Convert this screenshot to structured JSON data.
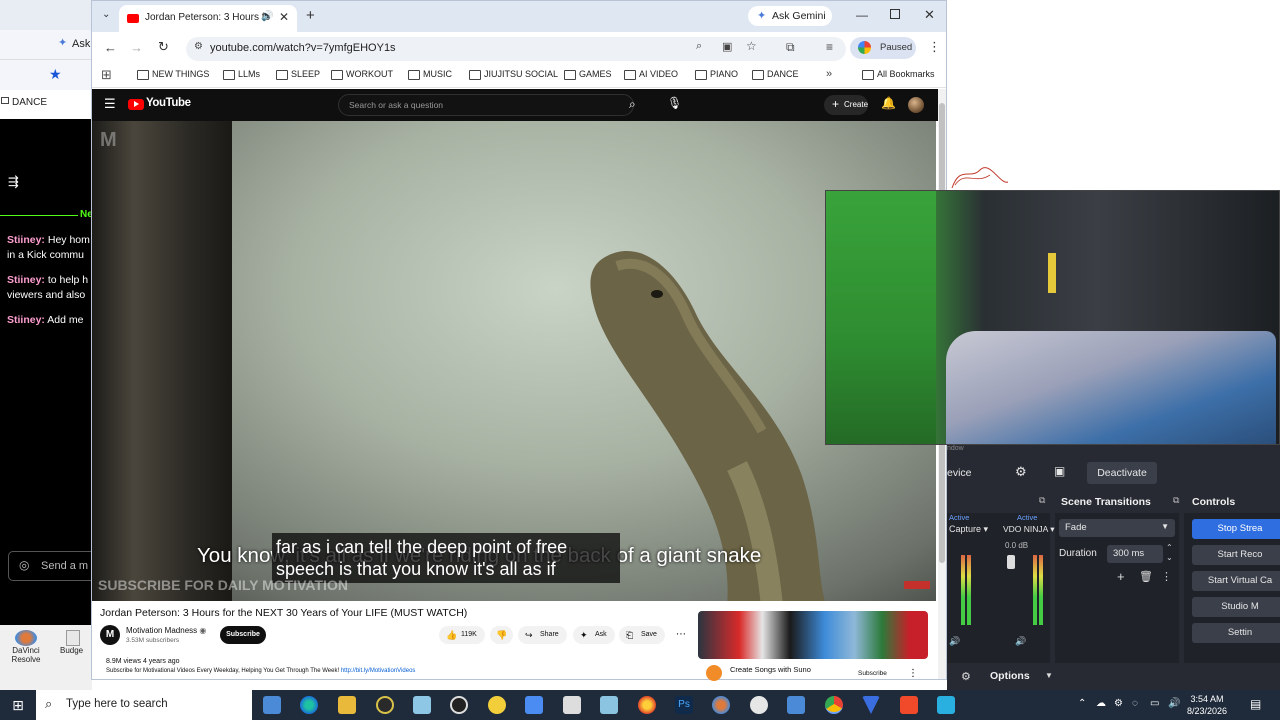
{
  "browser": {
    "tab_title": "Jordan Peterson: 3 Hours fo",
    "new_tab_symbol": "+",
    "ask_gemini": "Ask Gemini",
    "url": "youtube.com/watch?v=7ymfgEHOY1s",
    "profile_status": "Paused",
    "bookmarks": [
      "NEW THINGS",
      "LLMs",
      "SLEEP",
      "WORKOUT",
      "MUSIC",
      "JIUJITSU SOCIAL",
      "GAMES",
      "AI VIDEO",
      "PIANO",
      "DANCE"
    ],
    "all_bookmarks": "All Bookmarks"
  },
  "youtube": {
    "logo": "YouTube",
    "search_placeholder": "Search or ask a question",
    "create_label": "Create",
    "captions": {
      "line_a": "You know, it's all as if we're riding on the back of a giant snake",
      "line_b1": "far as i can tell the deep point of free",
      "line_b2": "speech is that you know it's all as if"
    },
    "video_watermark": "SUBSCRIBE FOR DAILY MOTIVATION",
    "video_title": "Jordan Peterson: 3 Hours for the NEXT 30 Years of Your LIFE (MUST WATCH)",
    "channel": {
      "avatar_letter": "M",
      "name": "Motivation Madness",
      "subs": "3.53M subscribers",
      "subscribe": "Subscribe"
    },
    "actions": {
      "likes": "119K",
      "share": "Share",
      "ask": "Ask",
      "save": "Save"
    },
    "meta": {
      "views": "8.9M views  4 years ago",
      "description": "Subscribe for Motivational Videos Every Weekday, Helping You Get Through The Week! ",
      "link": "http://bit.ly/MotivationVideos"
    },
    "ad": {
      "title": "Create Songs with Suno",
      "subscribe": "Subscribe"
    }
  },
  "left_panel": {
    "ask_tab": "Ask",
    "dance_bookmark": "DANCE",
    "chat_new_marker": "Ne",
    "chat": [
      {
        "user": "Stiiney:",
        "text": " Hey hom"
      },
      {
        "user": "",
        "text": "in a Kick commu"
      },
      {
        "user": "Stiiney:",
        "text": " to help h"
      },
      {
        "user": "",
        "text": "viewers and also"
      },
      {
        "user": "Stiiney:",
        "text": " Add me"
      }
    ],
    "send_placeholder": "Send a m",
    "desktop_icons": [
      "DaVinci Resolve",
      "Budge"
    ]
  },
  "obs": {
    "device_label": "evice",
    "deactivate": "Deactivate",
    "scene_transitions_title": "Scene Transitions",
    "controls_title": "Controls",
    "mixer": {
      "active_a": "Active",
      "active_b": "Active",
      "source_a": "Capture",
      "source_b": "VDO NINJA",
      "level": "0.0 dB"
    },
    "transition": {
      "type": "Fade",
      "duration_label": "Duration",
      "duration_value": "300 ms"
    },
    "controls": [
      "Stop Strea",
      "Start Reco",
      "Start Virtual Ca",
      "Studio M",
      "Settin"
    ],
    "options": "Options",
    "window_label": "ndow"
  },
  "taskbar": {
    "search_placeholder": "Type here to search",
    "time": "3:54 AM",
    "date": "8/23/2026"
  },
  "colors": {
    "chrome_tab_strip": "#dfe7f3",
    "youtube_dark": "#0f0f0f",
    "youtube_red": "#ff0000",
    "obs_bg": "#272a33",
    "obs_accent": "#2f6ee0",
    "kick_green": "#53fc18",
    "taskbar": "#1f2b3a"
  }
}
